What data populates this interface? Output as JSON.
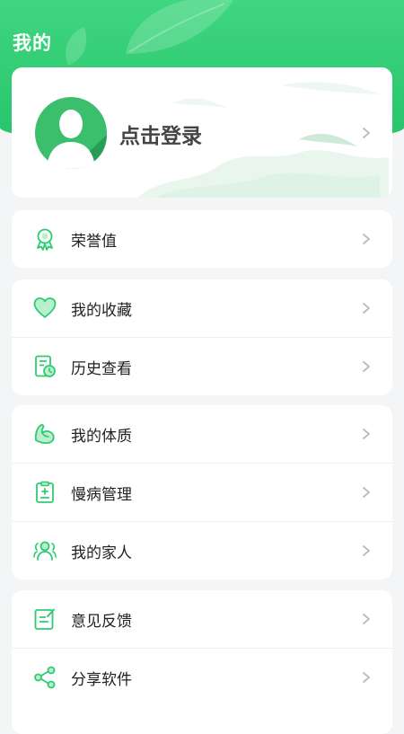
{
  "page": {
    "title": "我的"
  },
  "login": {
    "text": "点击登录"
  },
  "menu": {
    "honor": {
      "label": "荣誉值"
    },
    "favorites": {
      "label": "我的收藏"
    },
    "history": {
      "label": "历史查看"
    },
    "constitution": {
      "label": "我的体质"
    },
    "chronic": {
      "label": "慢病管理"
    },
    "family": {
      "label": "我的家人"
    },
    "feedback": {
      "label": "意见反馈"
    },
    "share": {
      "label": "分享软件"
    }
  },
  "colors": {
    "accent": "#2ecc71",
    "header": "#30cc72",
    "text": "#222222",
    "chevron": "#bbbbbb"
  }
}
